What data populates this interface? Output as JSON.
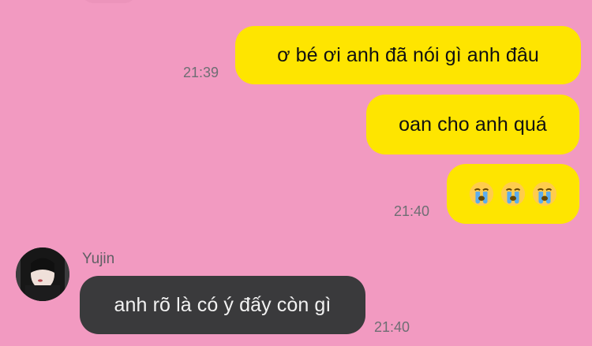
{
  "chat": {
    "messages": [
      {
        "id": "m1",
        "side": "outgoing",
        "text": "ơ bé ơi anh đã nói gì anh đâu",
        "time": "21:39"
      },
      {
        "id": "m2",
        "side": "outgoing",
        "text": "oan cho anh quá",
        "time": ""
      },
      {
        "id": "m3",
        "side": "outgoing",
        "emojis": [
          "loudly-crying-face",
          "loudly-crying-face",
          "loudly-crying-face"
        ],
        "time": "21:40"
      },
      {
        "id": "m4",
        "side": "incoming",
        "sender": "Yujin",
        "text": "anh rõ là có ý đấy còn gì",
        "time": "21:40"
      }
    ]
  },
  "colors": {
    "background": "#F29AC1",
    "outgoing_bubble": "#FEE500",
    "incoming_bubble": "#3A3A3C",
    "time_text": "#6E6E73"
  }
}
